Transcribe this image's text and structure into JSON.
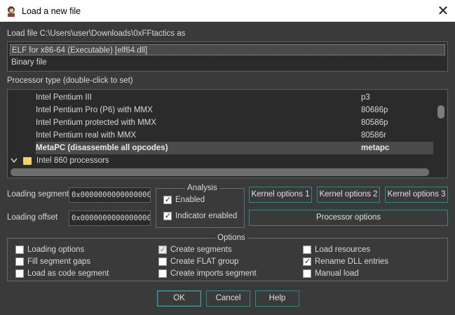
{
  "window": {
    "title": "Load a new file"
  },
  "load_file_label": "Load file C:\\Users\\user\\Downloads\\0xFFtactics as",
  "file_types": [
    {
      "label": "ELF for x86-64 (Executable) [elf64.dll]",
      "selected": true
    },
    {
      "label": "Binary file",
      "selected": false
    }
  ],
  "processor_type_label": "Processor type (double-click to set)",
  "processors": [
    {
      "name": "Intel Pentium III",
      "code": "p3",
      "bold": false
    },
    {
      "name": "Intel Pentium Pro (P6) with MMX",
      "code": "80686p",
      "bold": false
    },
    {
      "name": "Intel Pentium protected with MMX",
      "code": "80586p",
      "bold": false
    },
    {
      "name": "Intel Pentium real with MMX",
      "code": "80586r",
      "bold": false
    },
    {
      "name": "MetaPC (disassemble all opcodes)",
      "code": "metapc",
      "bold": true
    }
  ],
  "processor_group": {
    "label": "Intel 860 processors",
    "icon": "folder-icon",
    "expand_icon": "chevron-down-icon"
  },
  "loading_segment": {
    "label": "Loading segment",
    "value": "0x0000000000000000"
  },
  "loading_offset": {
    "label": "Loading offset",
    "value": "0x0000000000000000"
  },
  "analysis": {
    "title": "Analysis",
    "enabled": {
      "label": "Enabled",
      "checked": true
    },
    "indicator": {
      "label": "Indicator enabled",
      "checked": true
    }
  },
  "buttons": {
    "kernel1": "Kernel options 1",
    "kernel2": "Kernel options 2",
    "kernel3": "Kernel options 3",
    "processor_options": "Processor options",
    "ok": "OK",
    "cancel": "Cancel",
    "help": "Help"
  },
  "options": {
    "title": "Options",
    "loading_options": {
      "label": "Loading options",
      "checked": false
    },
    "fill_segment_gaps": {
      "label": "Fill segment gaps",
      "checked": false
    },
    "load_as_code_segment": {
      "label": "Load as code segment",
      "checked": false
    },
    "create_segments": {
      "label": "Create segments",
      "checked": true,
      "disabled": true
    },
    "create_flat_group": {
      "label": "Create FLAT group",
      "checked": false
    },
    "create_imports_segment": {
      "label": "Create imports segment",
      "checked": false
    },
    "load_resources": {
      "label": "Load resources",
      "checked": false
    },
    "rename_dll_entries": {
      "label": "Rename DLL entries",
      "checked": true
    },
    "manual_load": {
      "label": "Manual load",
      "checked": false
    }
  },
  "colors": {
    "background": "#3a3a3a",
    "panel": "#2b2b2b",
    "button_border": "#2f8a8a",
    "folder": "#f2d06b"
  }
}
